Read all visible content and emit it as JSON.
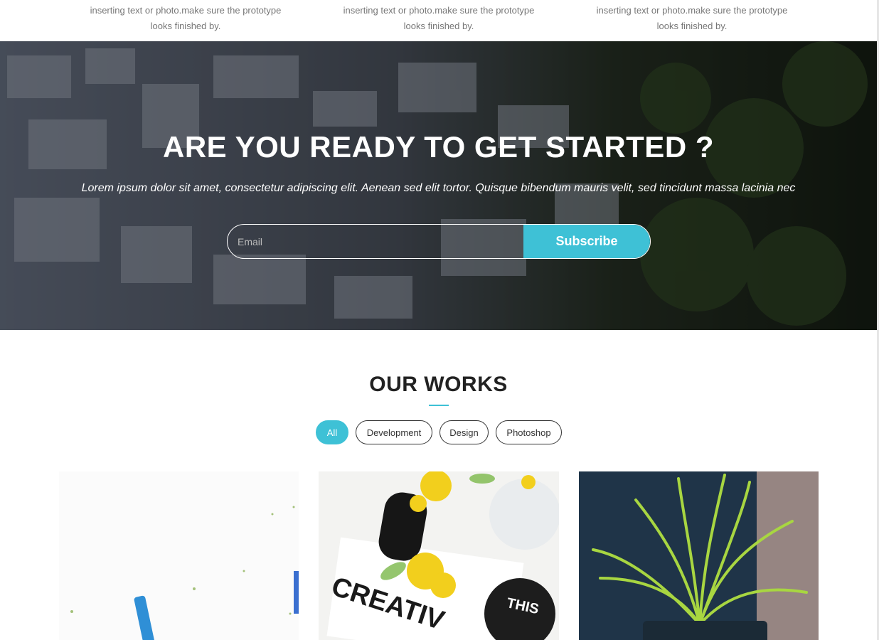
{
  "features": [
    {
      "text": "inserting text or photo.make sure the prototype looks finished by."
    },
    {
      "text": "inserting text or photo.make sure the prototype looks finished by."
    },
    {
      "text": "inserting text or photo.make sure the prototype looks finished by."
    }
  ],
  "cta": {
    "title": "ARE YOU READY TO GET STARTED ?",
    "subtitle": "Lorem ipsum dolor sit amet, consectetur adipiscing elit. Aenean sed elit tortor. Quisque bibendum mauris velit, sed tincidunt massa lacinia nec",
    "email_placeholder": "Email",
    "subscribe_label": "Subscribe"
  },
  "works": {
    "title": "OUR WORKS",
    "filters": [
      "All",
      "Development",
      "Design",
      "Photoshop"
    ],
    "active_filter": "All",
    "items": [
      {
        "image": "desk-pencil-photo"
      },
      {
        "image": "creative-mess-flowers-photo"
      },
      {
        "image": "potted-grass-plant-photo"
      }
    ]
  },
  "colors": {
    "accent": "#3ec1d6",
    "heading": "#222222",
    "body_text": "#777777"
  }
}
